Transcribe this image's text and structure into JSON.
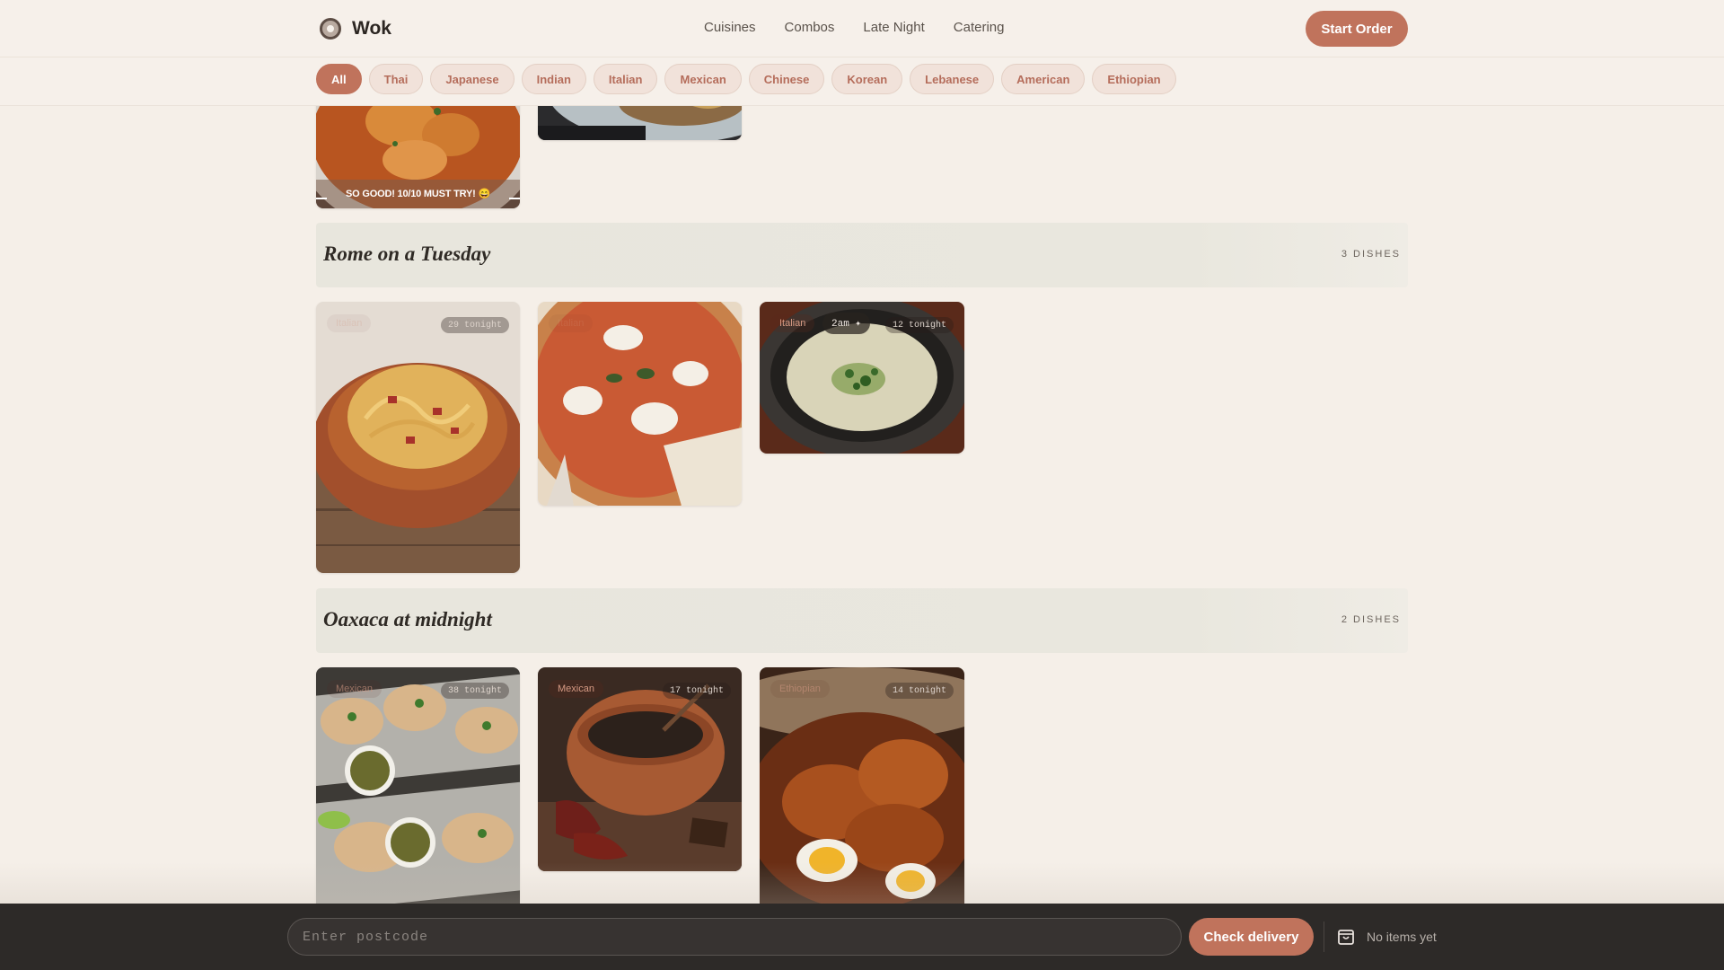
{
  "brand": {
    "name": "Wok"
  },
  "nav": {
    "items": [
      "Cuisines",
      "Combos",
      "Late Night",
      "Catering"
    ],
    "start_order": "Start Order"
  },
  "filters": [
    "All",
    "Thai",
    "Japanese",
    "Indian",
    "Italian",
    "Mexican",
    "Chinese",
    "Korean",
    "Lebanese",
    "American",
    "Ethiopian"
  ],
  "active_filter": "All",
  "top_row": {
    "caption": "SO GOOD! 10/10 MUST TRY! 😄"
  },
  "sections": [
    {
      "title": "Rome on a Tuesday",
      "count": "3 DISHES",
      "cards": [
        {
          "tag": "Italian",
          "count": "29 tonight"
        },
        {
          "tag": "Italian",
          "count": ""
        },
        {
          "tag": "Italian",
          "late": "2am ✦",
          "count": "12 tonight"
        }
      ]
    },
    {
      "title": "Oaxaca at midnight",
      "count": "2 DISHES",
      "cards": [
        {
          "tag": "Mexican",
          "count": "38 tonight"
        },
        {
          "tag": "Mexican",
          "count": "17 tonight"
        },
        {
          "tag": "Ethiopian",
          "count": "14 tonight"
        }
      ]
    }
  ],
  "footer": {
    "postcode_placeholder": "Enter postcode",
    "check_delivery": "Check delivery",
    "cart_label": "No items yet"
  },
  "colors": {
    "accent": "#c0735c",
    "background": "#f5efe8",
    "footer": "#2d2a28"
  },
  "icons": {
    "brand": "wok-logo-icon",
    "cart": "shopping-bag-icon"
  }
}
